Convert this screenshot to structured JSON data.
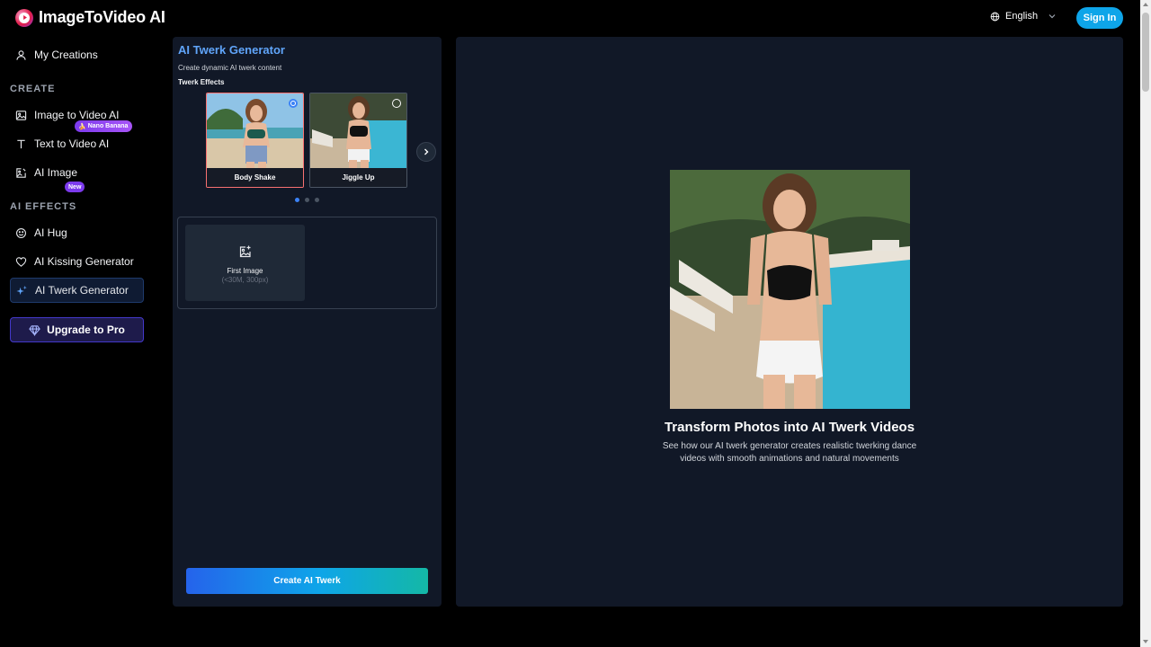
{
  "header": {
    "logo_text": "ImageToVideo AI",
    "language": "English",
    "signin_label": "Sign In"
  },
  "sidebar": {
    "my_creations": "My Creations",
    "create_section": "CREATE",
    "create_items": [
      {
        "label": "Image to Video AI",
        "icon": "image-icon"
      },
      {
        "label": "Text to Video AI",
        "icon": "text-icon"
      },
      {
        "label": "AI Image",
        "icon": "image-edit-icon",
        "badge": "Nano Banana"
      }
    ],
    "effects_section": "AI EFFECTS",
    "effects_items": [
      {
        "label": "AI Hug",
        "icon": "smile-icon",
        "badge": "New"
      },
      {
        "label": "AI Kissing Generator",
        "icon": "heart-icon"
      },
      {
        "label": "AI Twerk Generator",
        "icon": "sparkles-icon",
        "active": true
      }
    ],
    "upgrade_label": "Upgrade to Pro"
  },
  "tool": {
    "title": "AI Twerk Generator",
    "subtitle": "Create dynamic AI twerk content",
    "effects_label": "Twerk Effects",
    "effects": [
      {
        "name": "Body Shake",
        "selected": true
      },
      {
        "name": "Jiggle Up",
        "selected": false
      }
    ],
    "carousel_pages": 3,
    "carousel_active": 1,
    "upload": {
      "label": "First Image",
      "hint": "(<30M, 300px)"
    },
    "create_label": "Create AI Twerk"
  },
  "preview": {
    "title": "Transform Photos into AI Twerk Videos",
    "description": "See how our AI twerk generator creates realistic twerking dance videos with smooth animations and natural movements"
  },
  "colors": {
    "accent": "#0ea5e9",
    "title_blue": "#60a5fa",
    "selected_border": "#f87171",
    "panel_bg": "#111827",
    "page_bg": "#000000"
  }
}
